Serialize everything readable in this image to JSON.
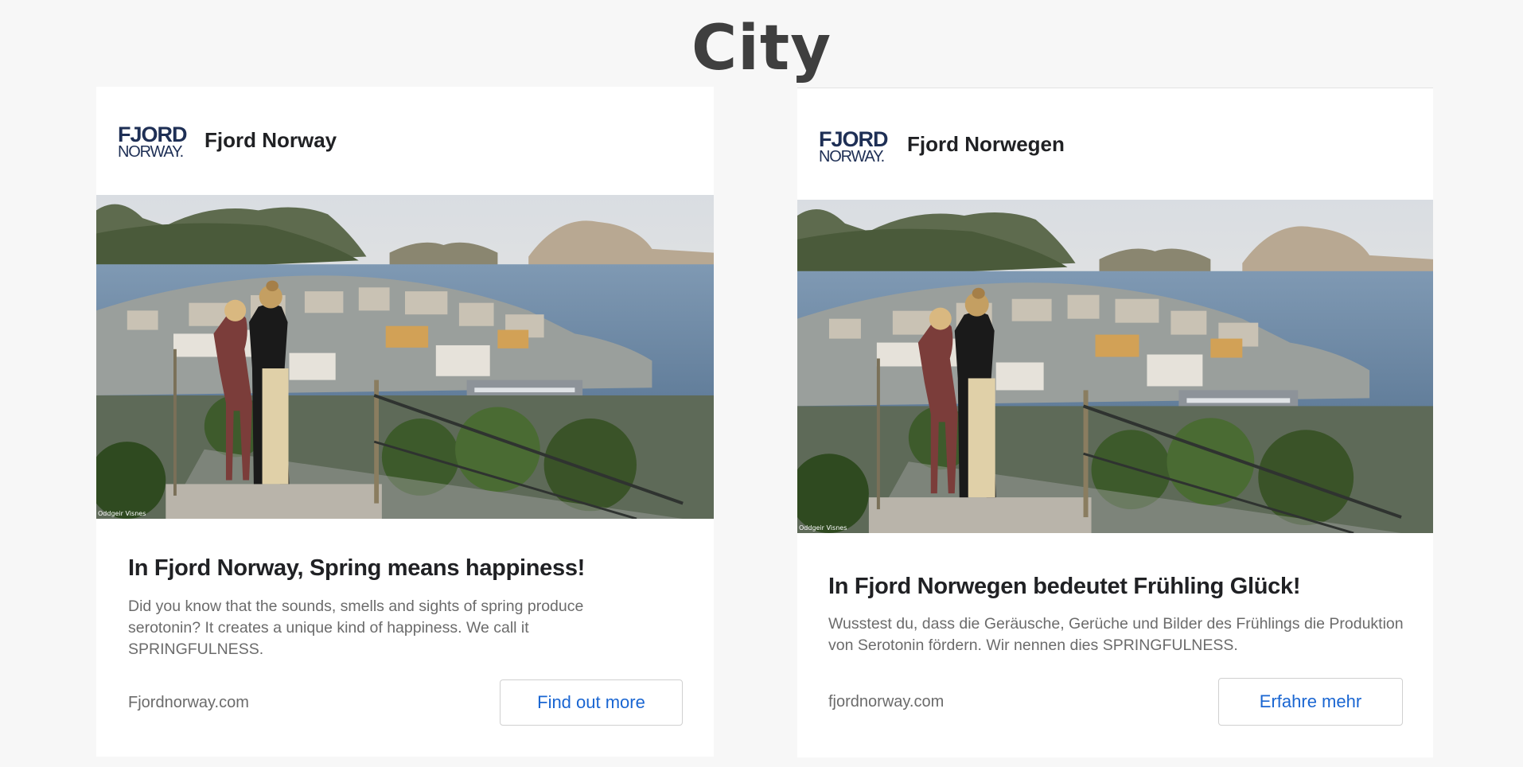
{
  "page": {
    "title": "City"
  },
  "ads": [
    {
      "logo_line1": "FJORD",
      "logo_line2": "NORWAY.",
      "advertiser": "Fjord Norway",
      "image_credit": "Oddgeir Visnes",
      "headline": "In Fjord Norway, Spring means happiness!",
      "description": "Did you know that the sounds, smells and sights of spring produce serotonin? It creates a unique kind of happiness. We call it SPRINGFULNESS.",
      "domain": "Fjordnorway.com",
      "cta": "Find out more"
    },
    {
      "logo_line1": "FJORD",
      "logo_line2": "NORWAY.",
      "advertiser": "Fjord Norwegen",
      "image_credit": "Oddgeir Visnes",
      "headline": "In Fjord Norwegen bedeutet Frühling Glück!",
      "description": "Wusstest du, dass die Geräusche, Gerüche und Bilder des Frühlings die Produktion von Serotonin fördern. Wir nennen dies SPRINGFULNESS.",
      "domain": "fjordnorway.com",
      "cta": "Erfahre mehr"
    }
  ],
  "colors": {
    "background": "#f7f7f7",
    "title": "#3f3f3f",
    "cta_text": "#1a66d2",
    "logo": "#1e2f55",
    "body_text": "#6b6b6b"
  }
}
